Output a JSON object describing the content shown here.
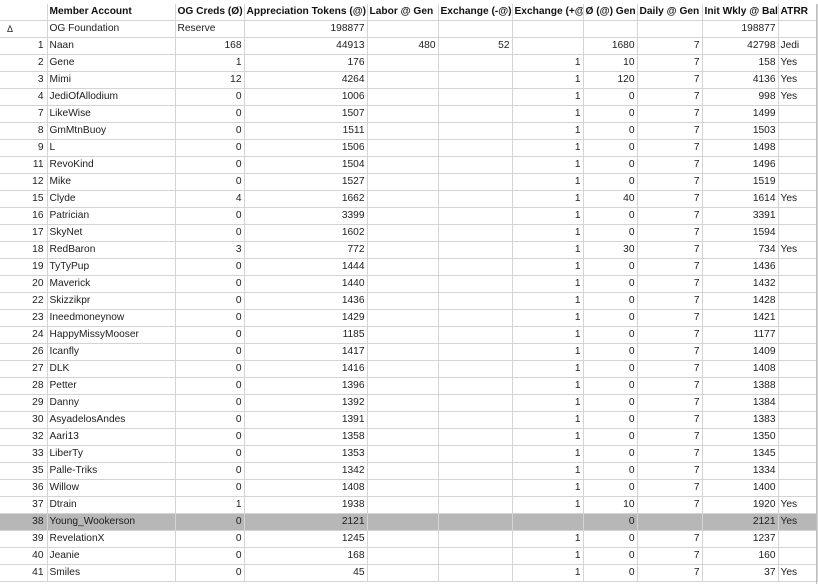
{
  "columns": [
    "",
    "Member Account",
    "OG Creds (Ø)",
    "Appreciation Tokens (@)",
    "Labor @ Gen",
    "Exchange (-@)",
    "Exchange (+@)",
    "Ø (@) Gen",
    "Daily @ Gen",
    "Init Wkly @ Bal",
    "ATRR"
  ],
  "rows": [
    {
      "idx": "Δ",
      "member": "OG Foundation",
      "og": "Reserve",
      "tokens": "198877",
      "labor": "",
      "exneg": "",
      "expos": "",
      "gen": "",
      "daily": "",
      "init": "198877",
      "atrr": ""
    },
    {
      "idx": "1",
      "member": "Naan",
      "og": "168",
      "tokens": "44913",
      "labor": "480",
      "exneg": "52",
      "expos": "",
      "gen": "1680",
      "daily": "7",
      "init": "42798",
      "atrr": "Jedi"
    },
    {
      "idx": "2",
      "member": "Gene",
      "og": "1",
      "tokens": "176",
      "labor": "",
      "exneg": "",
      "expos": "1",
      "gen": "10",
      "daily": "7",
      "init": "158",
      "atrr": "Yes"
    },
    {
      "idx": "3",
      "member": "Mimi",
      "og": "12",
      "tokens": "4264",
      "labor": "",
      "exneg": "",
      "expos": "1",
      "gen": "120",
      "daily": "7",
      "init": "4136",
      "atrr": "Yes"
    },
    {
      "idx": "4",
      "member": "JediOfAllodium",
      "og": "0",
      "tokens": "1006",
      "labor": "",
      "exneg": "",
      "expos": "1",
      "gen": "0",
      "daily": "7",
      "init": "998",
      "atrr": "Yes"
    },
    {
      "idx": "7",
      "member": "LikeWise",
      "og": "0",
      "tokens": "1507",
      "labor": "",
      "exneg": "",
      "expos": "1",
      "gen": "0",
      "daily": "7",
      "init": "1499",
      "atrr": ""
    },
    {
      "idx": "8",
      "member": "GmMtnBuoy",
      "og": "0",
      "tokens": "1511",
      "labor": "",
      "exneg": "",
      "expos": "1",
      "gen": "0",
      "daily": "7",
      "init": "1503",
      "atrr": ""
    },
    {
      "idx": "9",
      "member": "L",
      "og": "0",
      "tokens": "1506",
      "labor": "",
      "exneg": "",
      "expos": "1",
      "gen": "0",
      "daily": "7",
      "init": "1498",
      "atrr": ""
    },
    {
      "idx": "11",
      "member": "RevoKind",
      "og": "0",
      "tokens": "1504",
      "labor": "",
      "exneg": "",
      "expos": "1",
      "gen": "0",
      "daily": "7",
      "init": "1496",
      "atrr": ""
    },
    {
      "idx": "12",
      "member": "Mike",
      "og": "0",
      "tokens": "1527",
      "labor": "",
      "exneg": "",
      "expos": "1",
      "gen": "0",
      "daily": "7",
      "init": "1519",
      "atrr": ""
    },
    {
      "idx": "15",
      "member": "Clyde",
      "og": "4",
      "tokens": "1662",
      "labor": "",
      "exneg": "",
      "expos": "1",
      "gen": "40",
      "daily": "7",
      "init": "1614",
      "atrr": "Yes"
    },
    {
      "idx": "16",
      "member": "Patrician",
      "og": "0",
      "tokens": "3399",
      "labor": "",
      "exneg": "",
      "expos": "1",
      "gen": "0",
      "daily": "7",
      "init": "3391",
      "atrr": ""
    },
    {
      "idx": "17",
      "member": "SkyNet",
      "og": "0",
      "tokens": "1602",
      "labor": "",
      "exneg": "",
      "expos": "1",
      "gen": "0",
      "daily": "7",
      "init": "1594",
      "atrr": ""
    },
    {
      "idx": "18",
      "member": "RedBaron",
      "og": "3",
      "tokens": "772",
      "labor": "",
      "exneg": "",
      "expos": "1",
      "gen": "30",
      "daily": "7",
      "init": "734",
      "atrr": "Yes"
    },
    {
      "idx": "19",
      "member": "TyTyPup",
      "og": "0",
      "tokens": "1444",
      "labor": "",
      "exneg": "",
      "expos": "1",
      "gen": "0",
      "daily": "7",
      "init": "1436",
      "atrr": ""
    },
    {
      "idx": "20",
      "member": "Maverick",
      "og": "0",
      "tokens": "1440",
      "labor": "",
      "exneg": "",
      "expos": "1",
      "gen": "0",
      "daily": "7",
      "init": "1432",
      "atrr": ""
    },
    {
      "idx": "22",
      "member": "Skizzikpr",
      "og": "0",
      "tokens": "1436",
      "labor": "",
      "exneg": "",
      "expos": "1",
      "gen": "0",
      "daily": "7",
      "init": "1428",
      "atrr": ""
    },
    {
      "idx": "23",
      "member": "Ineedmoneynow",
      "og": "0",
      "tokens": "1429",
      "labor": "",
      "exneg": "",
      "expos": "1",
      "gen": "0",
      "daily": "7",
      "init": "1421",
      "atrr": ""
    },
    {
      "idx": "24",
      "member": "HappyMissyMooser",
      "og": "0",
      "tokens": "1185",
      "labor": "",
      "exneg": "",
      "expos": "1",
      "gen": "0",
      "daily": "7",
      "init": "1177",
      "atrr": ""
    },
    {
      "idx": "26",
      "member": "Icanfly",
      "og": "0",
      "tokens": "1417",
      "labor": "",
      "exneg": "",
      "expos": "1",
      "gen": "0",
      "daily": "7",
      "init": "1409",
      "atrr": ""
    },
    {
      "idx": "27",
      "member": "DLK",
      "og": "0",
      "tokens": "1416",
      "labor": "",
      "exneg": "",
      "expos": "1",
      "gen": "0",
      "daily": "7",
      "init": "1408",
      "atrr": ""
    },
    {
      "idx": "28",
      "member": "Petter",
      "og": "0",
      "tokens": "1396",
      "labor": "",
      "exneg": "",
      "expos": "1",
      "gen": "0",
      "daily": "7",
      "init": "1388",
      "atrr": ""
    },
    {
      "idx": "29",
      "member": "Danny",
      "og": "0",
      "tokens": "1392",
      "labor": "",
      "exneg": "",
      "expos": "1",
      "gen": "0",
      "daily": "7",
      "init": "1384",
      "atrr": ""
    },
    {
      "idx": "30",
      "member": "AsyadelosAndes",
      "og": "0",
      "tokens": "1391",
      "labor": "",
      "exneg": "",
      "expos": "1",
      "gen": "0",
      "daily": "7",
      "init": "1383",
      "atrr": ""
    },
    {
      "idx": "32",
      "member": "Aari13",
      "og": "0",
      "tokens": "1358",
      "labor": "",
      "exneg": "",
      "expos": "1",
      "gen": "0",
      "daily": "7",
      "init": "1350",
      "atrr": ""
    },
    {
      "idx": "33",
      "member": "LiberTy",
      "og": "0",
      "tokens": "1353",
      "labor": "",
      "exneg": "",
      "expos": "1",
      "gen": "0",
      "daily": "7",
      "init": "1345",
      "atrr": ""
    },
    {
      "idx": "35",
      "member": "Palle-Triks",
      "og": "0",
      "tokens": "1342",
      "labor": "",
      "exneg": "",
      "expos": "1",
      "gen": "0",
      "daily": "7",
      "init": "1334",
      "atrr": ""
    },
    {
      "idx": "36",
      "member": "Willow",
      "og": "0",
      "tokens": "1408",
      "labor": "",
      "exneg": "",
      "expos": "1",
      "gen": "0",
      "daily": "7",
      "init": "1400",
      "atrr": ""
    },
    {
      "idx": "37",
      "member": "Dtrain",
      "og": "1",
      "tokens": "1938",
      "labor": "",
      "exneg": "",
      "expos": "1",
      "gen": "10",
      "daily": "7",
      "init": "1920",
      "atrr": "Yes"
    },
    {
      "idx": "38",
      "member": "Young_Wookerson",
      "og": "0",
      "tokens": "2121",
      "labor": "",
      "exneg": "",
      "expos": "",
      "gen": "0",
      "daily": "",
      "init": "2121",
      "atrr": "Yes",
      "highlight": true
    },
    {
      "idx": "39",
      "member": "RevelationX",
      "og": "0",
      "tokens": "1245",
      "labor": "",
      "exneg": "",
      "expos": "1",
      "gen": "0",
      "daily": "7",
      "init": "1237",
      "atrr": ""
    },
    {
      "idx": "40",
      "member": "Jeanie",
      "og": "0",
      "tokens": "168",
      "labor": "",
      "exneg": "",
      "expos": "1",
      "gen": "0",
      "daily": "7",
      "init": "160",
      "atrr": ""
    },
    {
      "idx": "41",
      "member": "Smiles",
      "og": "0",
      "tokens": "45",
      "labor": "",
      "exneg": "",
      "expos": "1",
      "gen": "0",
      "daily": "7",
      "init": "37",
      "atrr": "Yes"
    }
  ]
}
